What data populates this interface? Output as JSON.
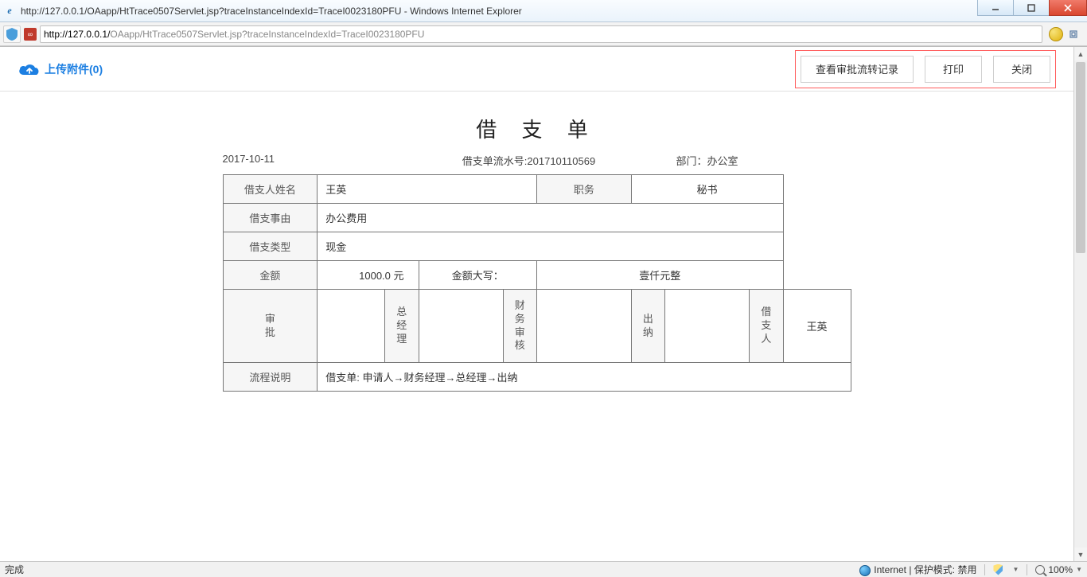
{
  "window": {
    "title": "http://127.0.0.1/OAapp/HtTrace0507Servlet.jsp?traceInstanceIndexId=TraceI0023180PFU - Windows Internet Explorer",
    "url_host": "http://127.0.0.1/",
    "url_path": "OAapp/HtTrace0507Servlet.jsp?traceInstanceIndexId=TraceI0023180PFU"
  },
  "toolbar": {
    "upload_label": "上传附件(0)",
    "view_records": "查看审批流转记录",
    "print": "打印",
    "close": "关闭"
  },
  "form": {
    "title": "借 支 单",
    "date": "2017-10-11",
    "serial_label": "借支单流水号:201710110569",
    "dept_label": "部门：办公室",
    "labels": {
      "name": "借支人姓名",
      "position": "职务",
      "reason": "借支事由",
      "type": "借支类型",
      "amount": "金额",
      "amount_caps_label": "金额大写：",
      "approval": "审批",
      "gm": "总经理",
      "fin_audit": "财务审核",
      "cashier": "出纳",
      "borrower": "借支人",
      "flow_label": "流程说明"
    },
    "values": {
      "name": "王英",
      "position": "秘书",
      "reason": "办公费用",
      "type": "现金",
      "amount": "1000.0 元",
      "amount_caps": "壹仟元整",
      "borrower_sign": "王英",
      "flow": "借支单: 申请人→财务经理→总经理→出纳"
    }
  },
  "status": {
    "done": "完成",
    "zone": "Internet | 保护模式: 禁用",
    "zoom": "100%"
  }
}
